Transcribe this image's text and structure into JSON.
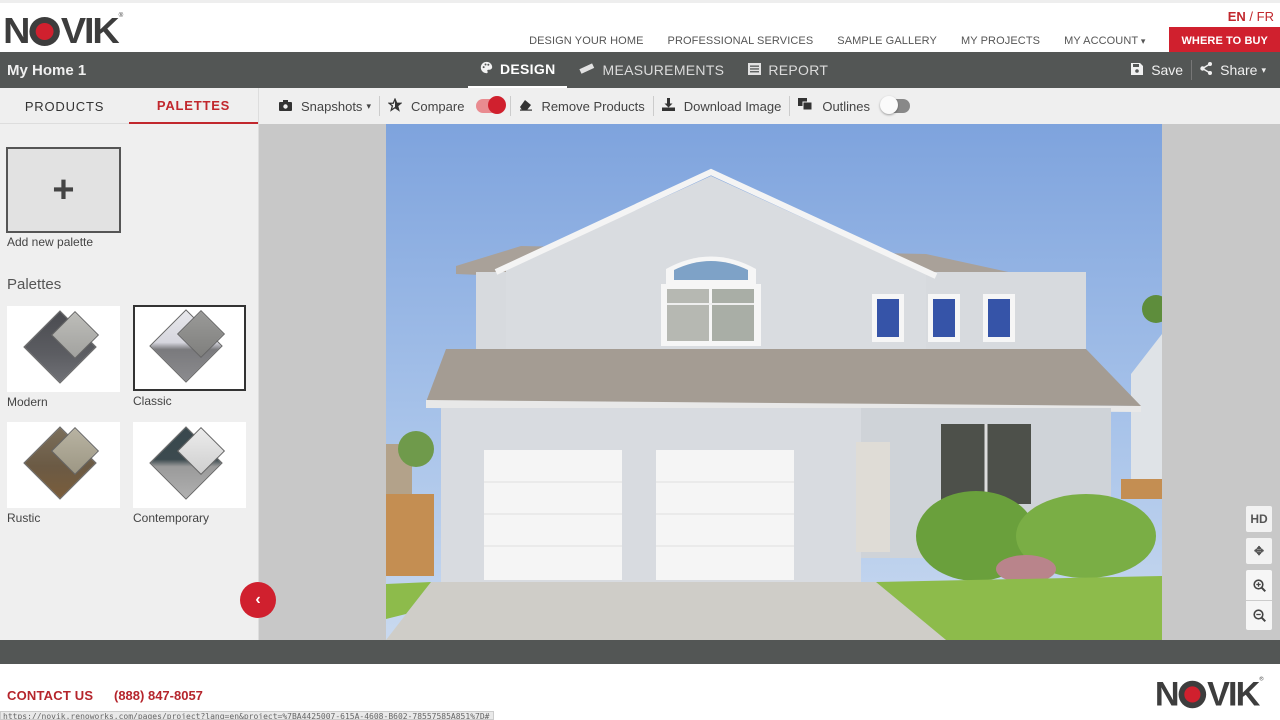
{
  "brand": {
    "name_prefix": "N",
    "name_suffix": "VIK",
    "registered": "®",
    "accent_color": "#d0202e"
  },
  "language": {
    "current": "EN",
    "separator": "/",
    "alternate": "FR"
  },
  "top_nav": {
    "items": [
      {
        "label": "DESIGN YOUR HOME"
      },
      {
        "label": "PROFESSIONAL SERVICES"
      },
      {
        "label": "SAMPLE GALLERY"
      },
      {
        "label": "MY PROJECTS"
      },
      {
        "label": "MY ACCOUNT"
      }
    ],
    "cta_label": "WHERE TO BUY"
  },
  "app_bar": {
    "project_name": "My Home 1",
    "mode_tabs": [
      {
        "label": "DESIGN",
        "icon": "palette-icon",
        "active": true
      },
      {
        "label": "MEASUREMENTS",
        "icon": "ruler-icon",
        "active": false
      },
      {
        "label": "REPORT",
        "icon": "list-icon",
        "active": false
      }
    ],
    "save_label": "Save",
    "share_label": "Share"
  },
  "left_panel": {
    "tabs": [
      {
        "label": "PRODUCTS",
        "active": false
      },
      {
        "label": "PALETTES",
        "active": true
      }
    ],
    "add_palette_label": "Add new palette",
    "palettes_heading": "Palettes",
    "palettes": [
      {
        "name": "Modern",
        "selected": false,
        "colors": [
          "#4a4b50",
          "#a9a9a6"
        ]
      },
      {
        "name": "Classic",
        "selected": true,
        "colors": [
          "#8a8a8d",
          "#8f8f8c"
        ]
      },
      {
        "name": "Rustic",
        "selected": false,
        "colors": [
          "#6b5a44",
          "#a8a290"
        ]
      },
      {
        "name": "Contemporary",
        "selected": false,
        "colors": [
          "#39484d",
          "#d8d8d8"
        ]
      }
    ]
  },
  "toolbar": {
    "snapshots_label": "Snapshots",
    "compare_label": "Compare",
    "compare_on": true,
    "remove_products_label": "Remove Products",
    "download_image_label": "Download Image",
    "outlines_label": "Outlines",
    "outlines_on": false
  },
  "canvas": {
    "hd_label": "HD",
    "photo_description": "Two-story house with light grey siding and double garage"
  },
  "footer": {
    "contact_label": "CONTACT US",
    "phone": "(888) 847-8057"
  },
  "status_bar": {
    "url": "https://novik.renoworks.com/pages/project?lang=en&project=%7BA4425007-615A-4608-B602-78557585A851%7D#"
  }
}
